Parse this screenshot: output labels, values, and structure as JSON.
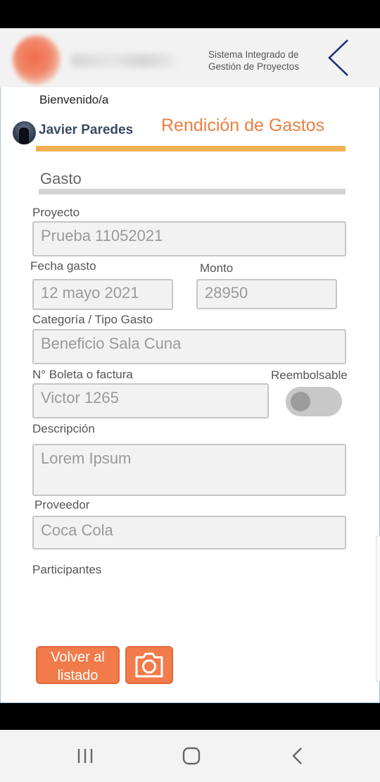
{
  "header": {
    "system_name": "Sistema Integrado de Gestión de Proyectos"
  },
  "user": {
    "welcome": "Bienvenido/a",
    "name": "Javier Paredes"
  },
  "page": {
    "title": "Rendición de Gastos",
    "section": "Gasto"
  },
  "form": {
    "proyecto": {
      "label": "Proyecto",
      "value": "Prueba 11052021"
    },
    "fecha": {
      "label": "Fecha gasto",
      "value": "12 mayo 2021"
    },
    "monto": {
      "label": "Monto",
      "value": "28950"
    },
    "categoria": {
      "label": "Categoría / Tipo Gasto",
      "value": "Beneficio Sala Cuna"
    },
    "boleta": {
      "label": "N° Boleta o factura",
      "value": "Victor 1265"
    },
    "reembolsable": {
      "label": "Reembolsable",
      "checked": false
    },
    "descripcion": {
      "label": "Descripción",
      "value": "Lorem Ipsum"
    },
    "proveedor": {
      "label": "Proveedor",
      "value": "Coca Cola"
    },
    "participantes": {
      "label": "Participantes"
    }
  },
  "actions": {
    "back_label": "Volver al listado",
    "camera_icon": "camera-icon"
  },
  "colors": {
    "accent_orange": "#ec7f3e",
    "button_orange": "#f27b4b",
    "rule_orange": "#f0b251",
    "header_chevron": "#1d2d7a"
  }
}
